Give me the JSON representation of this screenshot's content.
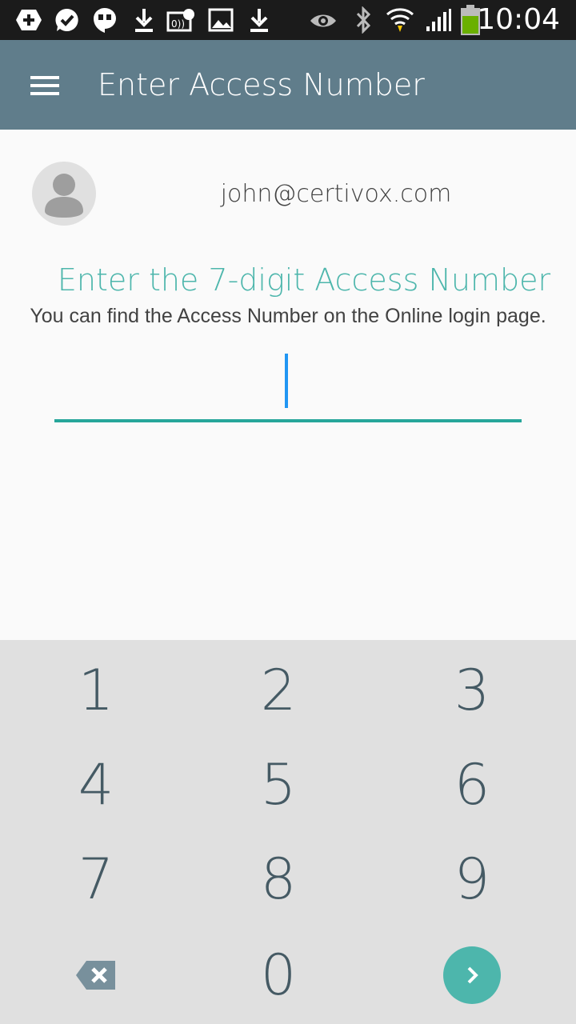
{
  "status_bar": {
    "time": "10:04",
    "icons": [
      "add-icon",
      "check-circle-icon",
      "hangouts-icon",
      "download-icon",
      "nfc-icon",
      "image-icon",
      "download-icon",
      "eye-icon",
      "bluetooth-icon",
      "wifi-icon",
      "signal-icon",
      "battery-icon"
    ],
    "battery_level": 0.7
  },
  "app_bar": {
    "title": "Enter Access Number",
    "menu_icon": "menu-icon",
    "color": "#607d8b"
  },
  "user": {
    "email": "john@certivox.com",
    "avatar_icon": "person-icon"
  },
  "prompt": {
    "title": "Enter the 7-digit Access Number",
    "subtitle": "You can find the Access Number on the Online login page."
  },
  "access_input": {
    "value": "",
    "accent": "#26a69a"
  },
  "keypad": {
    "keys": [
      "1",
      "2",
      "3",
      "4",
      "5",
      "6",
      "7",
      "8",
      "9",
      "0"
    ],
    "backspace_icon": "backspace-icon",
    "submit_icon": "chevron-right-icon",
    "accent": "#4db6ac"
  }
}
